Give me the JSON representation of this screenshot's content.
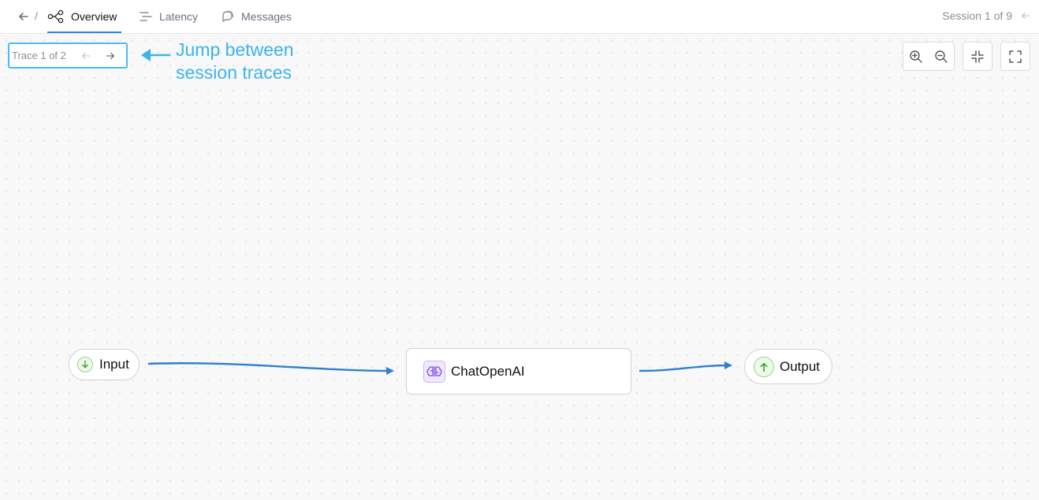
{
  "header": {
    "separator": "/",
    "tabs": [
      {
        "label": "Overview",
        "active": true
      },
      {
        "label": "Latency",
        "active": false
      },
      {
        "label": "Messages",
        "active": false
      }
    ],
    "session_label": "Session 1 of 9"
  },
  "canvas": {
    "trace_label": "Trace 1 of 2",
    "annotation": {
      "line1": "Jump between",
      "line2": "session traces",
      "color": "#3ab4ec"
    },
    "nodes": {
      "input": "Input",
      "chat": "ChatOpenAI",
      "output": "Output"
    },
    "edge_color": "#2f7fd1",
    "accent": "#2f80ed"
  }
}
